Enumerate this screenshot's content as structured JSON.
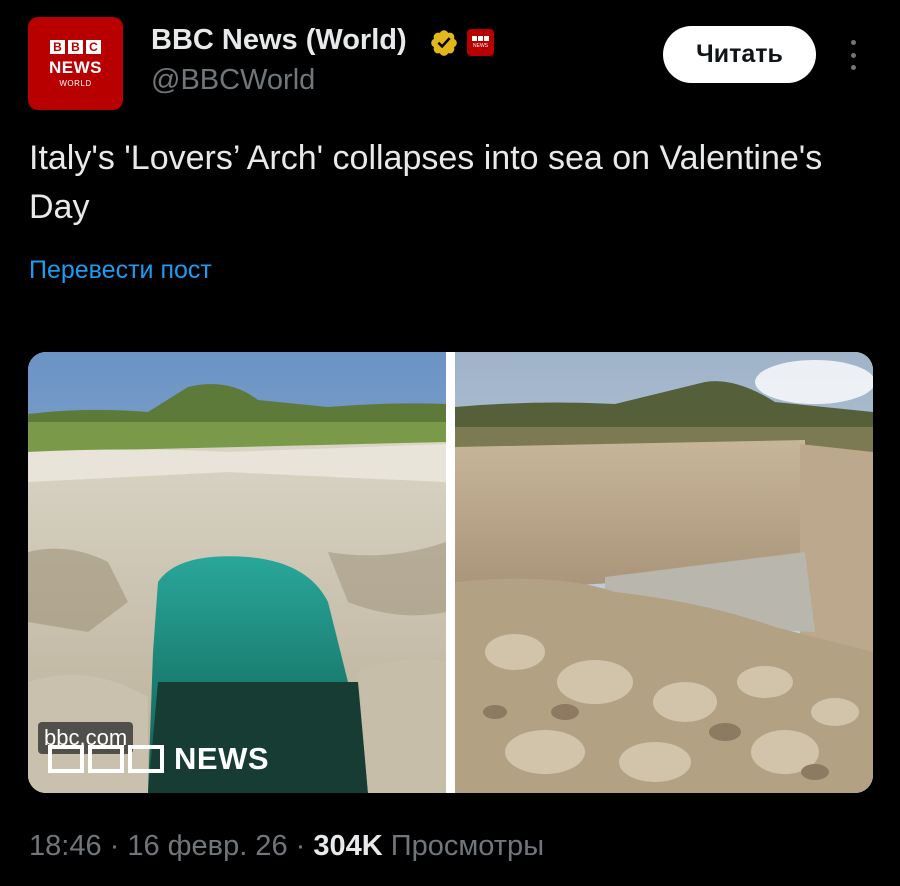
{
  "account": {
    "name": "BBC News (World)",
    "handle": "@BBCWorld",
    "avatar_blocks": [
      "B",
      "B",
      "C"
    ],
    "avatar_line1": "NEWS",
    "avatar_line2": "WORLD",
    "verified_badge": "gold-check-icon",
    "affiliate_badge": "bbc-news-affiliate-icon",
    "brand_color": "#b80000",
    "verified_color": "#e2b719"
  },
  "header": {
    "follow_label": "Читать",
    "more_icon": "more-vertical-icon"
  },
  "post": {
    "text": "Italy's 'Lovers’ Arch' collapses into sea on Valentine's Day",
    "translate_label": "Перевести пост",
    "link_color": "#1d9bf0"
  },
  "media": {
    "watermark_url": "bbc.com",
    "watermark_brand": "NEWS",
    "left_image": "sea-arch-before",
    "right_image": "sea-arch-collapsed-rubble"
  },
  "meta": {
    "time": "18:46",
    "sep1": " · ",
    "date": "16 февр. 26",
    "sep2": " · ",
    "views_count": "304K",
    "views_label": "Просмотры"
  }
}
